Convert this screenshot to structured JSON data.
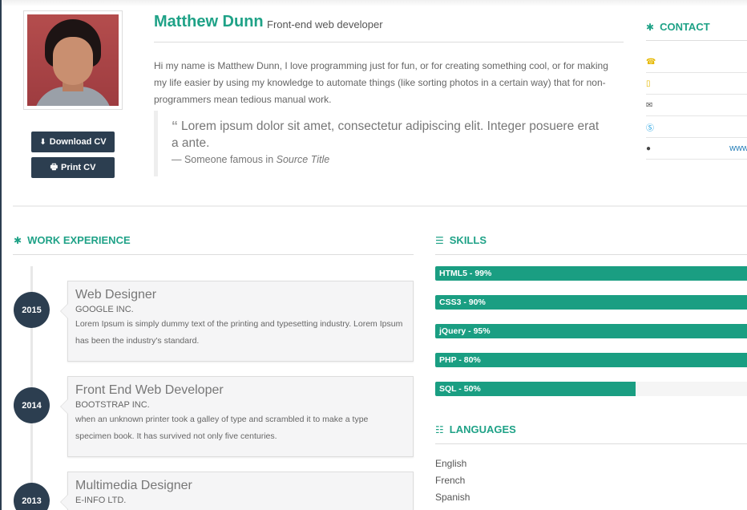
{
  "profile": {
    "name": "Matthew Dunn",
    "role": "Front-end web developer",
    "about": "Hi my name is Matthew Dunn, I love programming just for fun, or for creating something cool, or for making my life easier by using my knowledge to automate things (like sorting photos in a certain way) that for non-programmers mean tedious manual work.",
    "quote": {
      "text": "Lorem ipsum dolor sit amet, consectetur adipiscing elit. Integer posuere erat a ante.",
      "author": "— Someone famous in ",
      "source": "Source Title"
    },
    "photo_icon": "portrait-photo"
  },
  "buttons": {
    "download": {
      "label": "Download CV",
      "icon": "download-icon"
    },
    "print": {
      "label": "Print CV",
      "icon": "print-icon"
    }
  },
  "contact": {
    "title": "CONTACT",
    "rows": [
      {
        "icon": "phone-icon",
        "value": ""
      },
      {
        "icon": "mobile-icon",
        "value": ""
      },
      {
        "icon": "envelope-icon",
        "value": ""
      },
      {
        "icon": "skype-icon",
        "value": ""
      },
      {
        "icon": "globe-icon",
        "value": "www"
      }
    ]
  },
  "work": {
    "title": "WORK EXPERIENCE",
    "items": [
      {
        "year": "2015",
        "title": "Web Designer",
        "company": "GOOGLE INC.",
        "description": "Lorem Ipsum is simply dummy text of the printing and typesetting industry. Lorem Ipsum has been the industry's standard."
      },
      {
        "year": "2014",
        "title": "Front End Web Developer",
        "company": "BOOTSTRAP INC.",
        "description": "when an unknown printer took a galley of type and scrambled it to make a type specimen book. It has survived not only five centuries."
      },
      {
        "year": "2013",
        "title": "Multimedia Designer",
        "company": "E-INFO LTD.",
        "description": ""
      }
    ]
  },
  "skills": {
    "title": "SKILLS",
    "items": [
      {
        "label": "HTML5 - 99%",
        "percent": 99
      },
      {
        "label": "CSS3 - 90%",
        "percent": 90
      },
      {
        "label": "jQuery - 95%",
        "percent": 95
      },
      {
        "label": "PHP - 80%",
        "percent": 80
      },
      {
        "label": "SQL - 50%",
        "percent": 50
      }
    ]
  },
  "languages": {
    "title": "LANGUAGES",
    "items": [
      "English",
      "French",
      "Spanish"
    ]
  },
  "colors": {
    "accent": "#1fa287",
    "dark": "#2c3e50",
    "bar": "#1a9e82"
  }
}
